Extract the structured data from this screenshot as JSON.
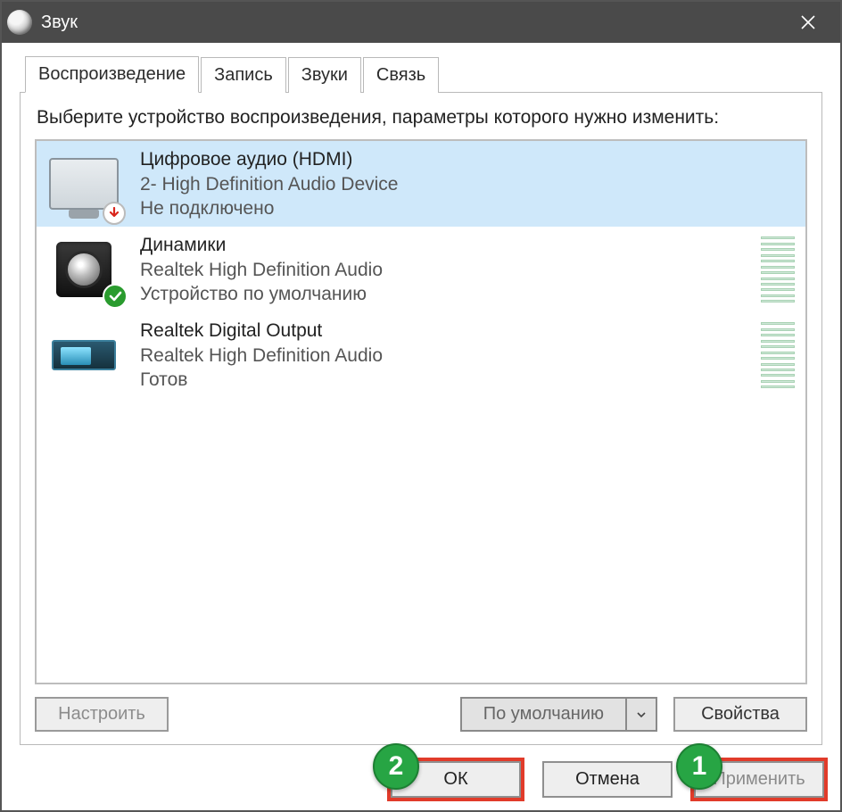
{
  "window": {
    "title": "Звук"
  },
  "tabs": [
    "Воспроизведение",
    "Запись",
    "Звуки",
    "Связь"
  ],
  "instruction": "Выберите устройство воспроизведения, параметры которого нужно изменить:",
  "devices": [
    {
      "name": "Цифровое аудио (HDMI)",
      "desc": "2- High Definition Audio Device",
      "status": "Не подключено",
      "selected": true,
      "icon": "monitor",
      "badge": "down-red",
      "meter": false
    },
    {
      "name": "Динамики",
      "desc": "Realtek High Definition Audio",
      "status": "Устройство по умолчанию",
      "selected": false,
      "icon": "speaker",
      "badge": "check-green",
      "meter": true
    },
    {
      "name": "Realtek Digital Output",
      "desc": "Realtek High Definition Audio",
      "status": "Готов",
      "selected": false,
      "icon": "optical",
      "badge": null,
      "meter": true
    }
  ],
  "buttons": {
    "configure": "Настроить",
    "set_default": "По умолчанию",
    "properties": "Свойства",
    "ok": "ОК",
    "cancel": "Отмена",
    "apply": "Применить"
  },
  "annotations": {
    "step1": "1",
    "step2": "2"
  }
}
